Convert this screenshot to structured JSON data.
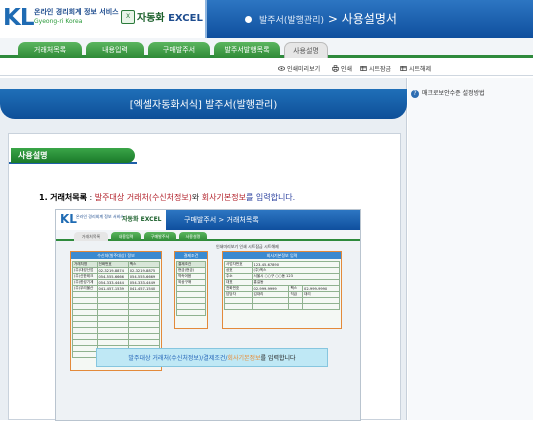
{
  "header": {
    "logo_text": "KL",
    "logo_sub1": "온라인 경리회계 정보 서비스",
    "logo_sub2": "Gyeong-ri Korea",
    "excel_title": "자동화 EXCEL",
    "excel_title_ko": "자동화",
    "excel_title_en": "EXCEL",
    "excel_mark": "X",
    "breadcrumb_main": "발주서(발행관리)",
    "breadcrumb_sep": ">",
    "breadcrumb_page": "사용설명서"
  },
  "tabs": [
    "거래처목록",
    "내용입력",
    "구매발주서",
    "발주서발행목록",
    "사용설명"
  ],
  "active_tab": 4,
  "toolbar": {
    "preview": "인쇄미리보기",
    "print": "인쇄",
    "sheet_protect": "시트잠금",
    "sheet_unprotect": "시트해제"
  },
  "sidepanel": {
    "help_label": "매크로보안수준 설정방법",
    "help_icon": "?"
  },
  "banner": {
    "title": "[엑셀자동화서식] 발주서(발행관리)"
  },
  "section": {
    "tag": "사용설명"
  },
  "instruction": {
    "num": "1.",
    "head": "거래처목록",
    "colon": ":",
    "part1": "발주대상 거래처(수신처정보)",
    "conj": "와",
    "part2": "회사기본정보",
    "tail": "를 입력합니다."
  },
  "inner": {
    "logo": "KL",
    "logo_sub": "온라인 경리회계 정보 서비스",
    "excel": "자동화 EXCEL",
    "breadcrumb": "구매발주서 > 거래처목록",
    "tabs": [
      "거래처목록",
      "내용입력",
      "구매발주서",
      "사용설명"
    ],
    "tools": "인쇄미리보기   인쇄   시트잠금   시트해제",
    "box1_header": "수신처(발주대상) 정보",
    "box1_cols": [
      "거래처명",
      "전화번호",
      "팩스"
    ],
    "box1_rows": [
      [
        "(주)대성산업",
        "02-3219-8874",
        "02-3219-8875"
      ],
      [
        "(주)신한테크",
        "054-555-6666",
        "054-555-6669"
      ],
      [
        "(주)한성기계",
        "054-333-4444",
        "054-333-4449"
      ],
      [
        "(주)우리물산",
        "041-457-1539",
        "041-457-1540"
      ]
    ],
    "box2_header": "결제조건",
    "box2_cols": [
      "결제조건"
    ],
    "box2_rows": [
      [
        "현금(현금)"
      ],
      [
        "약속어음"
      ],
      [
        "외상구매"
      ]
    ],
    "box3_header": "회사기본정보 입력",
    "box3_rows": [
      [
        "사업자번호",
        "123-45-67890"
      ],
      [
        "상호",
        "(주)엑스"
      ],
      [
        "주소",
        "서울시 ○○구 ○○동 123"
      ],
      [
        "대표",
        "홍길동"
      ],
      [
        "전화번호",
        "02-999-9999",
        "팩스",
        "02-999-9990"
      ],
      [
        "담당자",
        "김대리",
        "직급",
        "대리"
      ]
    ],
    "overlay_p1": "발주대상 거래처(수신처정보)",
    "overlay_sep": "/",
    "overlay_p2": "결제조건",
    "overlay_p3": "회사기본정보",
    "overlay_tail": "를 입력합니다"
  },
  "colors": {
    "header_blue": "#1f6bb3",
    "tab_green": "#2f8a37",
    "banner_blue": "#0e4f98",
    "highlight_red": "#b2202a",
    "overlay_bg": "#bfe8f5"
  }
}
